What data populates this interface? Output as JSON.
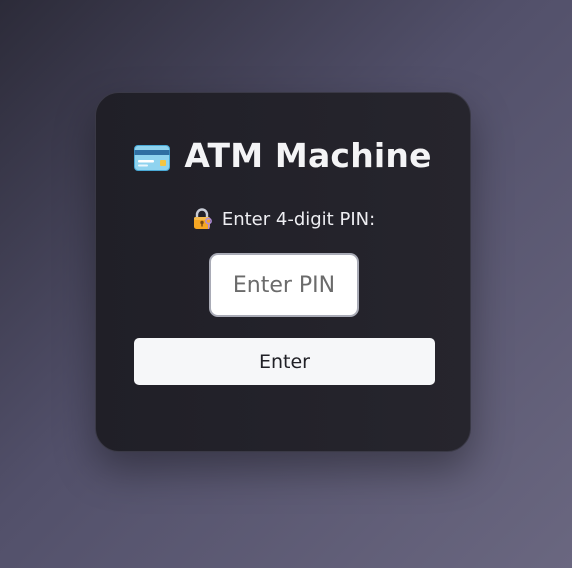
{
  "app": {
    "title": "ATM Machine",
    "title_icon": "credit-card-icon"
  },
  "pin_prompt": {
    "icon": "lock-with-key-icon",
    "label": "Enter 4-digit PIN:"
  },
  "pin_field": {
    "value": "",
    "placeholder": "Enter PIN"
  },
  "actions": {
    "enter_label": "Enter"
  },
  "colors": {
    "card_background": "#24232b",
    "title_text": "#f4f4f6",
    "button_background": "#f6f7f9",
    "input_border": "#a9abb6"
  }
}
